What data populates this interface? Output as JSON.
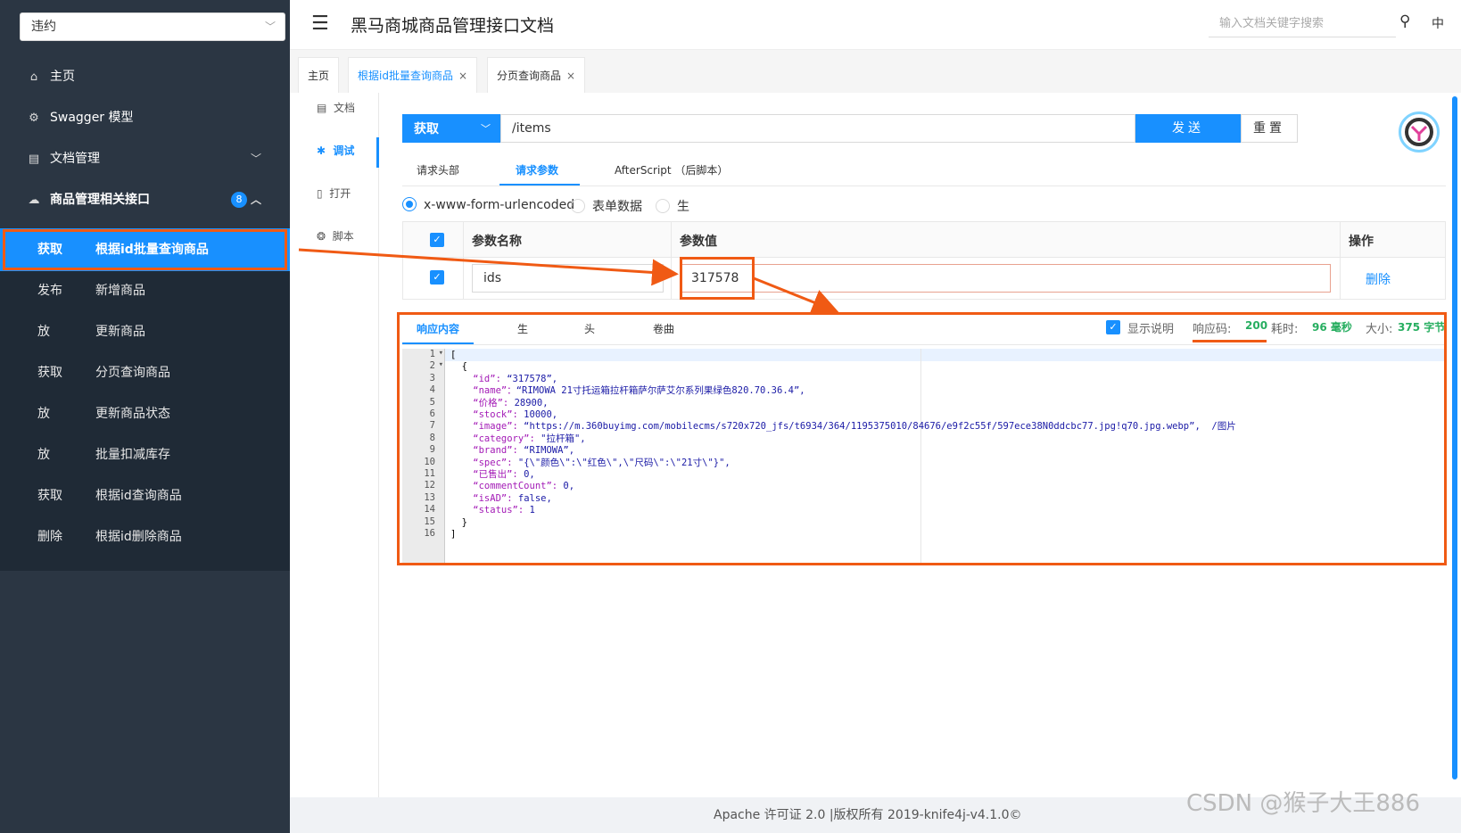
{
  "sidebar": {
    "doc_select": "违约",
    "menu": [
      {
        "icon": "home-icon",
        "glyph": "⌂",
        "label": "主页"
      },
      {
        "icon": "gear-icon",
        "glyph": "⚙",
        "label": "Swagger 模型"
      },
      {
        "icon": "document-icon",
        "glyph": "▤",
        "label": "文档管理"
      },
      {
        "icon": "cloud-icon",
        "glyph": "☁",
        "label": "商品管理相关接口",
        "badge": "8"
      }
    ],
    "items": [
      {
        "method": "获取",
        "label": "根据id批量查询商品"
      },
      {
        "method": "发布",
        "label": "新增商品"
      },
      {
        "method": "放",
        "label": "更新商品"
      },
      {
        "method": "获取",
        "label": "分页查询商品"
      },
      {
        "method": "放",
        "label": "更新商品状态"
      },
      {
        "method": "放",
        "label": "批量扣减库存"
      },
      {
        "method": "获取",
        "label": "根据id查询商品"
      },
      {
        "method": "删除",
        "label": "根据id删除商品"
      }
    ]
  },
  "header": {
    "title": "黑马商城商品管理接口文档",
    "search_placeholder": "输入文档关键字搜索",
    "lang": "中"
  },
  "tabs": [
    {
      "label": "主页"
    },
    {
      "label": "根据id批量查询商品",
      "close": "×"
    },
    {
      "label": "分页查询商品",
      "close": "×"
    }
  ],
  "side_tabs": [
    {
      "icon": "document-icon",
      "glyph": "▤",
      "label": "文档"
    },
    {
      "icon": "bug-icon",
      "glyph": "✱",
      "label": "调试"
    },
    {
      "icon": "open-icon",
      "glyph": "▯",
      "label": "打开"
    },
    {
      "icon": "script-icon",
      "glyph": "❂",
      "label": "脚本"
    }
  ],
  "request": {
    "method": "获取",
    "url": "/items",
    "send": "发送",
    "reset": "重置"
  },
  "param_tabs": [
    "请求头部",
    "请求参数",
    "AfterScript （后脚本）"
  ],
  "body_types": [
    "x-www-form-urlencoded",
    "表单数据",
    "生"
  ],
  "params_table": {
    "headers": [
      "参数名称",
      "参数值",
      "操作"
    ],
    "rows": [
      {
        "name": "ids",
        "value": "317578",
        "action": "删除"
      }
    ]
  },
  "response": {
    "tabs": [
      "响应内容",
      "生",
      "头",
      "卷曲"
    ],
    "show_desc": "显示说明",
    "code_label": "响应码:",
    "code": "200",
    "time_label": "耗时:",
    "time": "96 毫秒",
    "size_label": "大小:",
    "size": "375 字节",
    "code_lines": [
      "[",
      "  {",
      "    “id”: “317578”,",
      "    “name”：“RIMOWA 21寸托运箱拉杆箱萨尔萨艾尔系列果绿色820.70.36.4”,",
      "    “价格”: 28900,",
      "    “stock”: 10000,",
      "    “image”: “https://m.360buyimg.com/mobilecms/s720x720_jfs/t6934/364/1195375010/84676/e9f2c55f/597ece38N0ddcbc77.jpg!q70.jpg.webp”,  /图片",
      "    “category”: \"拉杆箱\",",
      "    “brand”: “RIMOWA”,",
      "    “spec”: \"{\\\"颜色\\\":\\\"红色\\\",\\\"尺码\\\":\\\"21寸\\\"}\",",
      "    “已售出”: 0,",
      "    “commentCount”: 0,",
      "    “isAD”: false,",
      "    “status”: 1",
      "  }",
      "]"
    ]
  },
  "footer": {
    "text": "Apache 许可证 2.0 |版权所有 2019-knife4j-v4.1.0©",
    "watermark": "CSDN @猴子大王886"
  },
  "colors": {
    "primary": "#1890ff",
    "sidebar": "#2b3643",
    "highlight": "#f05a14",
    "success": "#27ae60"
  }
}
